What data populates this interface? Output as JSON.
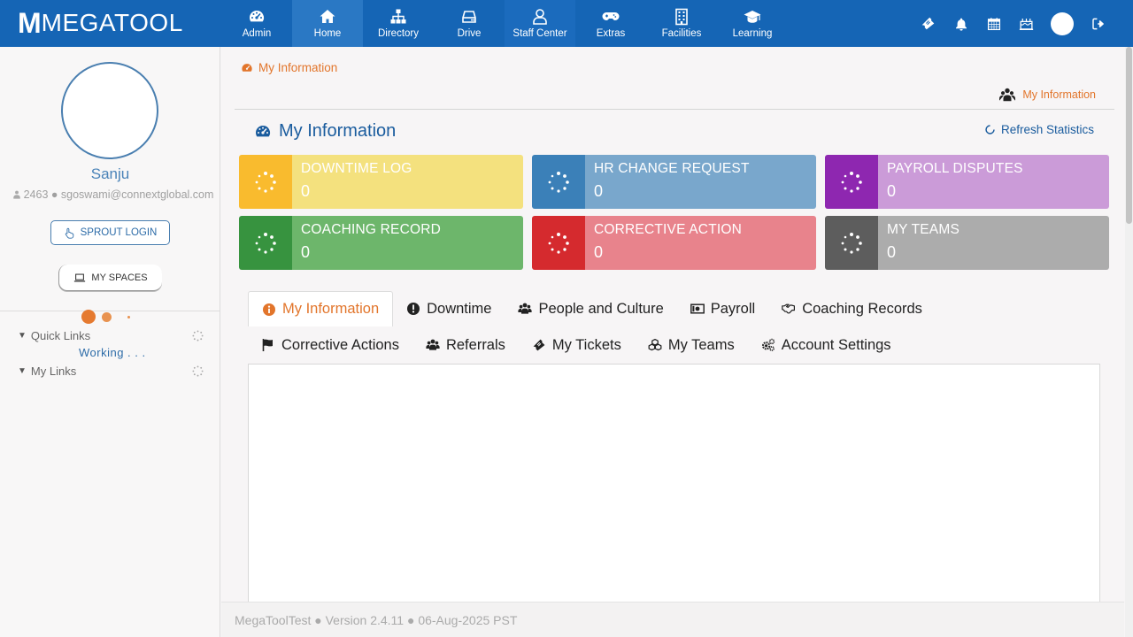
{
  "brand": {
    "letter": "M",
    "name": "MEGATOOL"
  },
  "nav": [
    {
      "label": "Admin",
      "icon": "dashboard-icon"
    },
    {
      "label": "Home",
      "icon": "home-icon",
      "active": true
    },
    {
      "label": "Directory",
      "icon": "sitemap-icon"
    },
    {
      "label": "Drive",
      "icon": "hdd-icon"
    },
    {
      "label": "Staff Center",
      "icon": "user-icon"
    },
    {
      "label": "Extras",
      "icon": "gamepad-icon"
    },
    {
      "label": "Facilities",
      "icon": "building-icon"
    },
    {
      "label": "Learning",
      "icon": "graduation-cap-icon"
    }
  ],
  "header_icons": [
    "ticket-icon",
    "bell-icon",
    "calendar-icon",
    "birthday-cake-icon",
    "user-avatar",
    "logout-icon"
  ],
  "profile": {
    "name": "Sanju",
    "info": "2463 ● sgoswami@connextglobal.com",
    "sprout_label": "SPROUT LOGIN",
    "spaces_label": "MY SPACES"
  },
  "links": {
    "quick_links": "Quick Links",
    "working": "Working . . .",
    "my_links": "My Links"
  },
  "breadcrumb": "My Information",
  "crumb_right": "My Information",
  "page_title": "My Information",
  "refresh_label": "Refresh Statistics",
  "cards": [
    {
      "title": "DOWNTIME LOG",
      "value": "0",
      "icon_bg": "#f9bb2e",
      "body_bg": "#f4e17e"
    },
    {
      "title": "HR CHANGE REQUEST",
      "value": "0",
      "icon_bg": "#3b80b8",
      "body_bg": "#79a7cc"
    },
    {
      "title": "PAYROLL DISPUTES",
      "value": "0",
      "icon_bg": "#8e27b0",
      "body_bg": "#cb9bd8"
    },
    {
      "title": "COACHING RECORD",
      "value": "0",
      "icon_bg": "#37933f",
      "body_bg": "#6db66b"
    },
    {
      "title": "CORRECTIVE ACTION",
      "value": "0",
      "icon_bg": "#d52a2e",
      "body_bg": "#e8838c"
    },
    {
      "title": "MY TEAMS",
      "value": "0",
      "icon_bg": "#5d5d5d",
      "body_bg": "#acacac"
    }
  ],
  "tabs_row1": [
    {
      "label": "My Information",
      "icon": "info-circle-icon",
      "active": true
    },
    {
      "label": "Downtime",
      "icon": "exclamation-circle-icon"
    },
    {
      "label": "People and Culture",
      "icon": "users-icon"
    },
    {
      "label": "Payroll",
      "icon": "money-bill-icon"
    },
    {
      "label": "Coaching Records",
      "icon": "handshake-icon"
    }
  ],
  "tabs_row2": [
    {
      "label": "Corrective Actions",
      "icon": "flag-icon"
    },
    {
      "label": "Referrals",
      "icon": "users-icon"
    },
    {
      "label": "My Tickets",
      "icon": "ticket-icon"
    },
    {
      "label": "My Teams",
      "icon": "cubes-icon"
    },
    {
      "label": "Account Settings",
      "icon": "cogs-icon"
    }
  ],
  "footer": "MegaToolTest ● Version 2.4.11 ● 06-Aug-2025 PST"
}
